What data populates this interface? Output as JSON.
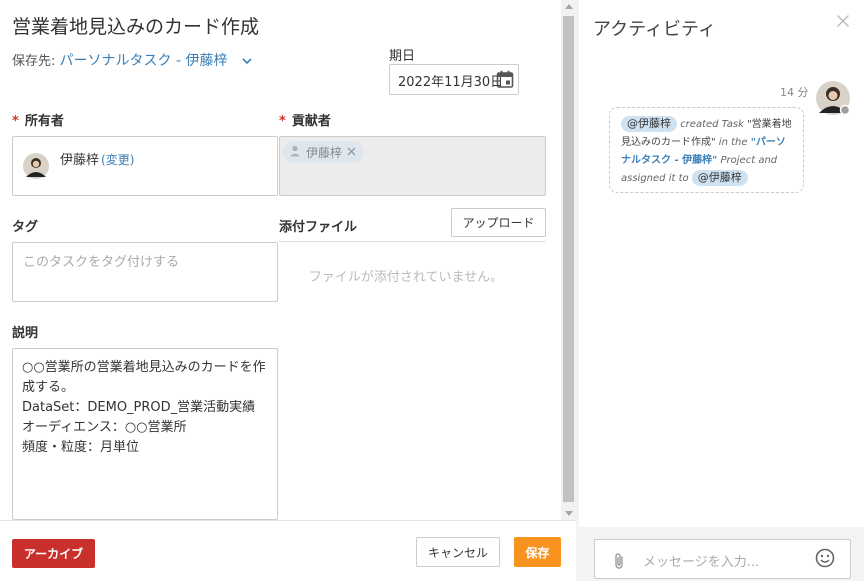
{
  "task": {
    "title": "営業着地見込みのカード作成",
    "save_dest_label": "保存先:",
    "save_dest_value": "パーソナルタスク - 伊藤梓",
    "due_label": "期日",
    "due_value": "2022年11月30日"
  },
  "owner": {
    "label": "所有者",
    "name": "伊藤梓",
    "change_label": "(変更)"
  },
  "contributors": {
    "label": "貢献者",
    "chips": [
      "伊藤梓"
    ]
  },
  "tags": {
    "label": "タグ",
    "placeholder": "このタスクをタグ付けする"
  },
  "attachments": {
    "label": "添付ファイル",
    "upload_label": "アップロード",
    "empty_text": "ファイルが添付されていません。"
  },
  "description": {
    "label": "説明",
    "text": "○○営業所の営業着地見込みのカードを作成する。\nDataSet：DEMO_PROD_営業活動実績\nオーディエンス：○○営業所\n頻度・粒度：月単位"
  },
  "footer": {
    "archive_label": "アーカイブ",
    "cancel_label": "キャンセル",
    "save_label": "保存"
  },
  "activity": {
    "title": "アクティビティ",
    "time": "14 分",
    "mention_actor": "@伊藤梓",
    "text_created": "created Task",
    "task_quote": "\"営業着地見込みのカード作成\"",
    "text_in_the": "in the",
    "project_quote": "\"パーソナルタスク - 伊藤梓\"",
    "text_project": "Project",
    "text_assigned": "and assigned it to",
    "mention_assignee": "@伊藤梓",
    "message_placeholder": "メッセージを入力..."
  },
  "colors": {
    "accent_link": "#3a7fb8",
    "archive": "#c9302c",
    "save": "#f7931e",
    "required": "#d0342c"
  }
}
